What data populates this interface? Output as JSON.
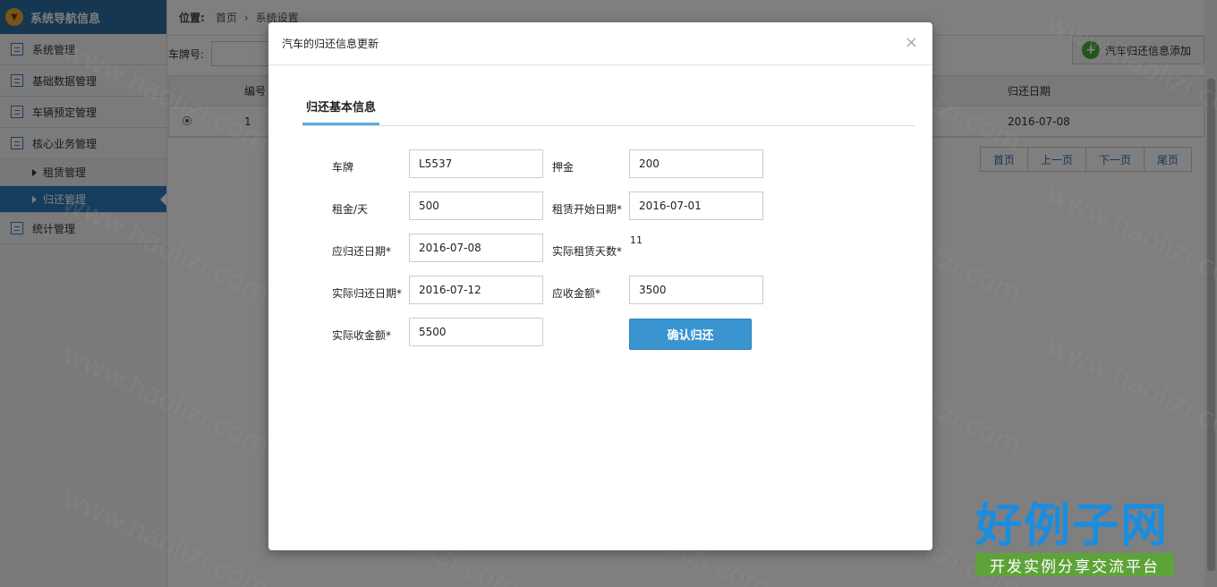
{
  "sidebar": {
    "title": "系统导航信息",
    "items": [
      {
        "label": "系统管理"
      },
      {
        "label": "基础数据管理"
      },
      {
        "label": "车辆预定管理"
      },
      {
        "label": "核心业务管理"
      }
    ],
    "sub_items": [
      {
        "label": "租赁管理"
      },
      {
        "label": "归还管理"
      }
    ],
    "last_item": {
      "label": "统计管理"
    }
  },
  "breadcrumb": {
    "prefix": "位置:",
    "home": "首页",
    "sep": "›",
    "current": "系统设置"
  },
  "filter": {
    "label": "车牌号:"
  },
  "add_button": {
    "label": "汽车归还信息添加"
  },
  "table": {
    "headers": {
      "id": "编号",
      "return_date": "归还日期"
    },
    "rows": [
      {
        "id": "1",
        "return_date": "2016-07-08"
      }
    ]
  },
  "pager": {
    "first": "首页",
    "prev": "上一页",
    "next": "下一页",
    "last": "尾页"
  },
  "modal": {
    "title": "汽车的归还信息更新",
    "close": "×",
    "tab": "归还基本信息",
    "fields": {
      "plate": {
        "label": "车牌",
        "value": "L5537"
      },
      "deposit": {
        "label": "押金",
        "value": "200"
      },
      "rent_per_day": {
        "label": "租金/天",
        "value": "500"
      },
      "start_date": {
        "label": "租赁开始日期*",
        "value": "2016-07-01"
      },
      "due_date": {
        "label": "应归还日期*",
        "value": "2016-07-08"
      },
      "actual_days": {
        "label": "实际租赁天数*",
        "value": "11"
      },
      "actual_return_date": {
        "label": "实际归还日期*",
        "value": "2016-07-12"
      },
      "receivable": {
        "label": "应收金额*",
        "value": "3500"
      },
      "actual_received": {
        "label": "实际收金额*",
        "value": "5500"
      }
    },
    "confirm_label": "确认归还"
  },
  "watermark": {
    "text": "www.haolizi.com",
    "brand_big": "好例子网",
    "brand_small": "开发实例分享交流平台"
  }
}
